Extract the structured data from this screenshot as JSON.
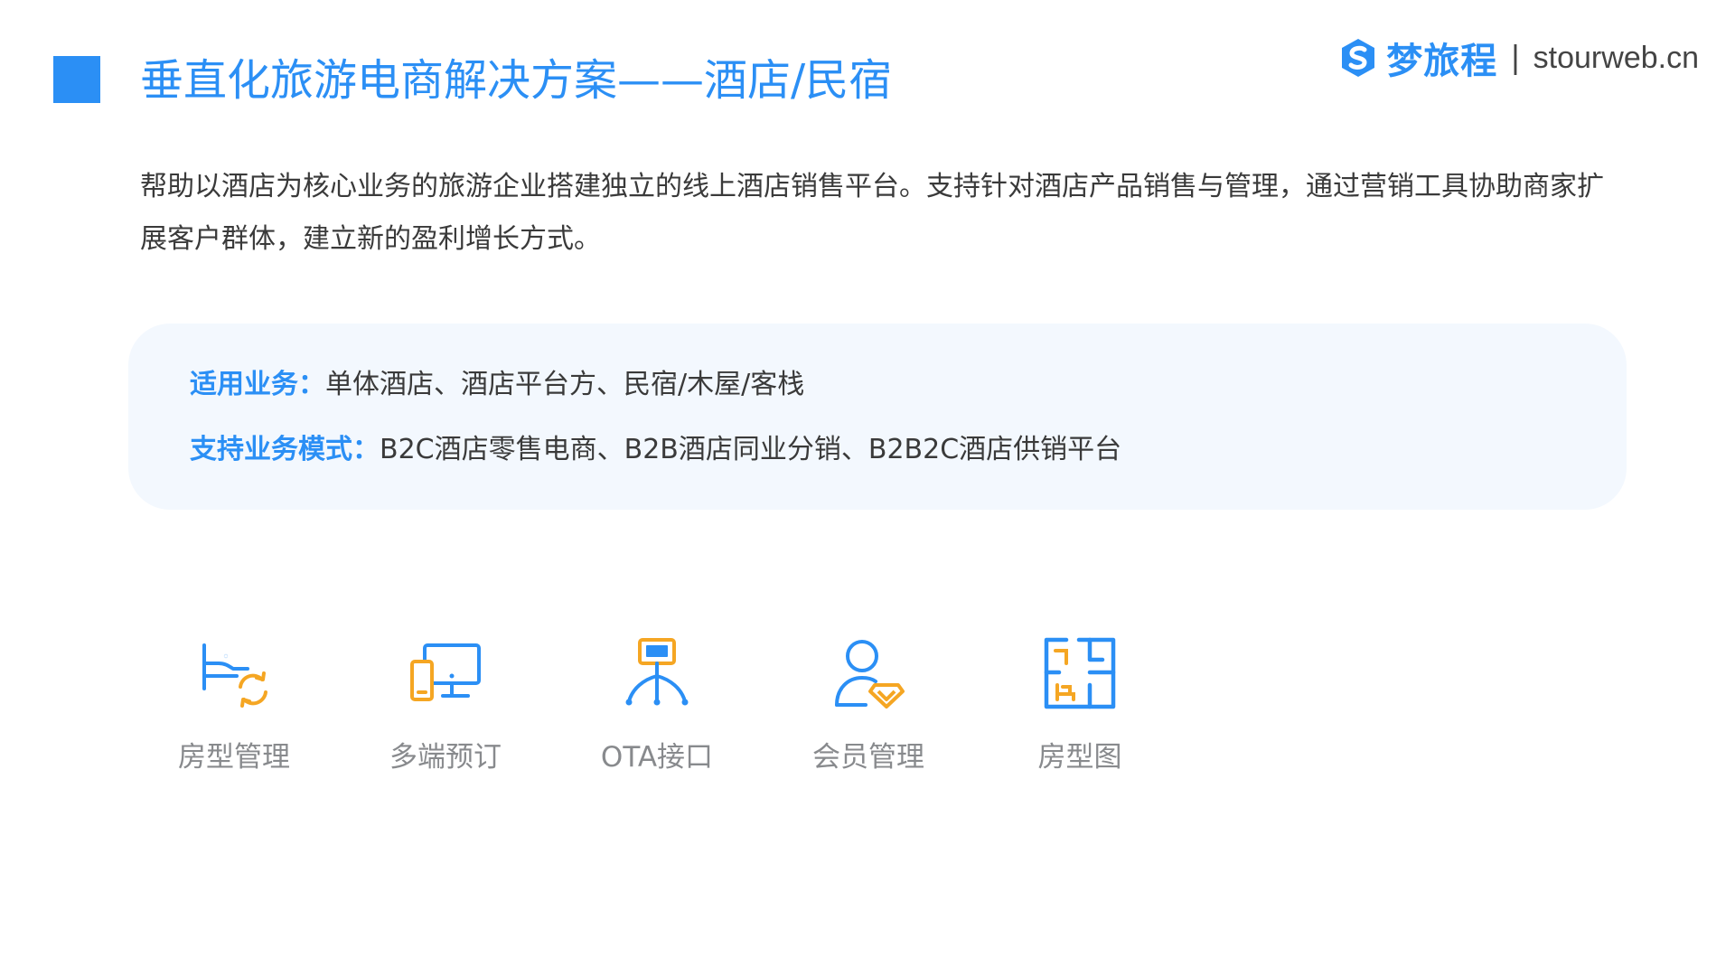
{
  "header": {
    "title": "垂直化旅游电商解决方案——酒店/民宿",
    "brand_name": "梦旅程",
    "brand_separator": "|",
    "brand_domain": "stourweb.cn"
  },
  "intro": {
    "text": "帮助以酒店为核心业务的旅游企业搭建独立的线上酒店销售平台。支持针对酒店产品销售与管理，通过营销工具协助商家扩展客户群体，建立新的盈利增长方式。"
  },
  "info": {
    "applicable_label": "适用业务：",
    "applicable_value": "单体酒店、酒店平台方、民宿/木屋/客栈",
    "mode_label": "支持业务模式：",
    "mode_value": "B2C酒店零售电商、B2B酒店同业分销、B2B2C酒店供销平台"
  },
  "features": [
    {
      "label": "房型管理",
      "icon": "bed-refresh-icon"
    },
    {
      "label": "多端预订",
      "icon": "multi-device-icon"
    },
    {
      "label": "OTA接口",
      "icon": "network-interface-icon"
    },
    {
      "label": "会员管理",
      "icon": "member-diamond-icon"
    },
    {
      "label": "房型图",
      "icon": "floor-plan-icon"
    }
  ],
  "colors": {
    "accent_blue": "#2b8ff5",
    "accent_orange": "#f5a623",
    "body_text": "#3a3a3a",
    "muted_text": "#888a8d",
    "panel_bg": "#f3f8fe"
  }
}
